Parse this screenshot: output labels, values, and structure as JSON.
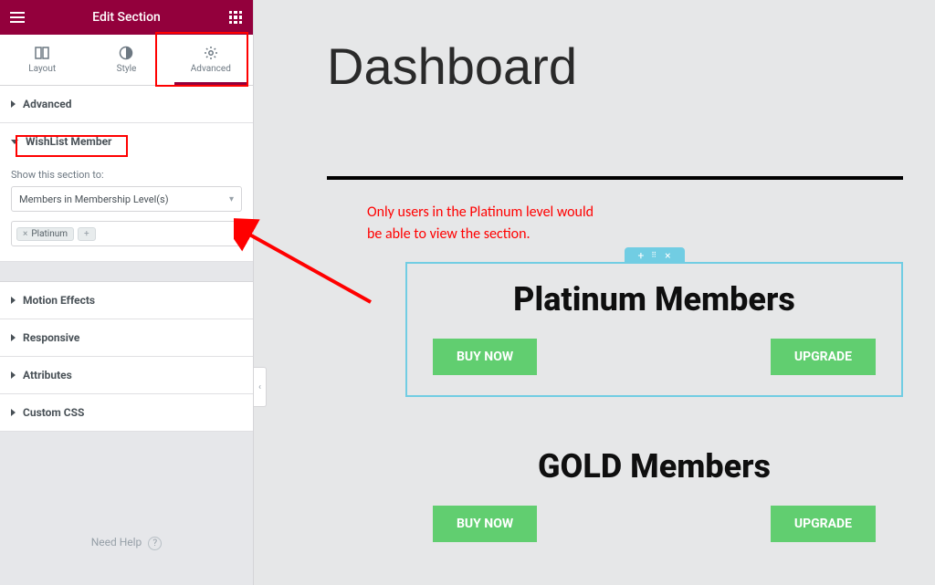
{
  "panel": {
    "title": "Edit Section",
    "tabs": {
      "layout": "Layout",
      "style": "Style",
      "advanced": "Advanced",
      "active": "advanced"
    },
    "accordion": {
      "advanced": "Advanced",
      "wishlist": "WishList Member",
      "motion": "Motion Effects",
      "responsive": "Responsive",
      "attributes": "Attributes",
      "customcss": "Custom CSS"
    },
    "wishlist_section": {
      "field_label": "Show this section to:",
      "dropdown_value": "Members in Membership Level(s)",
      "tags": [
        "Platinum"
      ]
    },
    "need_help": "Need Help"
  },
  "annotation": {
    "line1": "Only users in the Platinum level would",
    "line2": "be able to view the section."
  },
  "canvas": {
    "title": "Dashboard",
    "section1": {
      "title": "Platinum Members",
      "btn_buy": "BUY NOW",
      "btn_upgrade": "UPGRADE"
    },
    "section2": {
      "title": "GOLD Members",
      "btn_buy": "BUY NOW",
      "btn_upgrade": "UPGRADE"
    },
    "handle": {
      "plus": "+",
      "close": "×"
    }
  }
}
